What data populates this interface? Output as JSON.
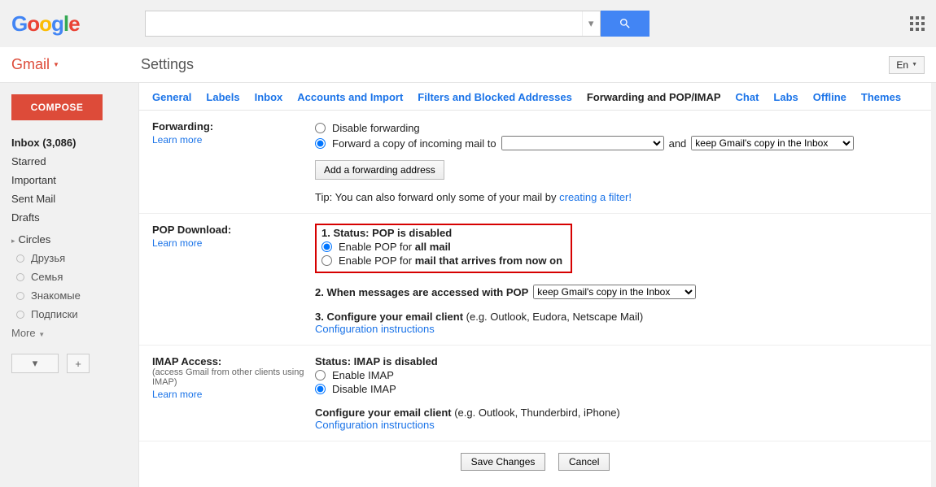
{
  "header": {
    "search_placeholder": "",
    "lang_label": "En"
  },
  "gmail_dropdown": "Gmail",
  "page_title": "Settings",
  "sidebar": {
    "compose": "COMPOSE",
    "items": [
      {
        "label": "Inbox (3,086)",
        "bold": true
      },
      {
        "label": "Starred"
      },
      {
        "label": "Important"
      },
      {
        "label": "Sent Mail"
      },
      {
        "label": "Drafts"
      }
    ],
    "circles_header": "Circles",
    "circles": [
      "Друзья",
      "Семья",
      "Знакомые",
      "Подписки"
    ],
    "more": "More",
    "mini_dd": "▾",
    "mini_plus": "+"
  },
  "tabs": [
    "General",
    "Labels",
    "Inbox",
    "Accounts and Import",
    "Filters and Blocked Addresses",
    "Forwarding and POP/IMAP",
    "Chat",
    "Labs",
    "Offline",
    "Themes"
  ],
  "active_tab": 5,
  "forwarding": {
    "title": "Forwarding:",
    "learn": "Learn more",
    "disable_label": "Disable forwarding",
    "forward_copy_prefix": "Forward a copy of incoming mail to",
    "forward_and": "and",
    "select_address": "",
    "select_action": "keep Gmail's copy in the Inbox",
    "add_btn": "Add a forwarding address",
    "tip_prefix": "Tip: You can also forward only some of your mail by ",
    "tip_link": "creating a filter!"
  },
  "pop": {
    "title": "POP Download:",
    "learn": "Learn more",
    "status_line": "1. Status: POP is disabled",
    "opt1_prefix": "Enable POP for ",
    "opt1_bold": "all mail",
    "opt2_prefix": "Enable POP for ",
    "opt2_bold": "mail that arrives from now on",
    "step2_prefix": "2. When messages are accessed with POP",
    "step2_select": "keep Gmail's copy in the Inbox",
    "step3_prefix": "3. Configure your email client ",
    "step3_eg": "(e.g. Outlook, Eudora, Netscape Mail)",
    "cfg_link": "Configuration instructions"
  },
  "imap": {
    "title": "IMAP Access:",
    "sub": "(access Gmail from other clients using IMAP)",
    "learn": "Learn more",
    "status": "Status: IMAP is disabled",
    "enable": "Enable IMAP",
    "disable": "Disable IMAP",
    "cfg_title": "Configure your email client ",
    "cfg_eg": "(e.g. Outlook, Thunderbird, iPhone)",
    "cfg_link": "Configuration instructions"
  },
  "footer": {
    "save": "Save Changes",
    "cancel": "Cancel"
  }
}
